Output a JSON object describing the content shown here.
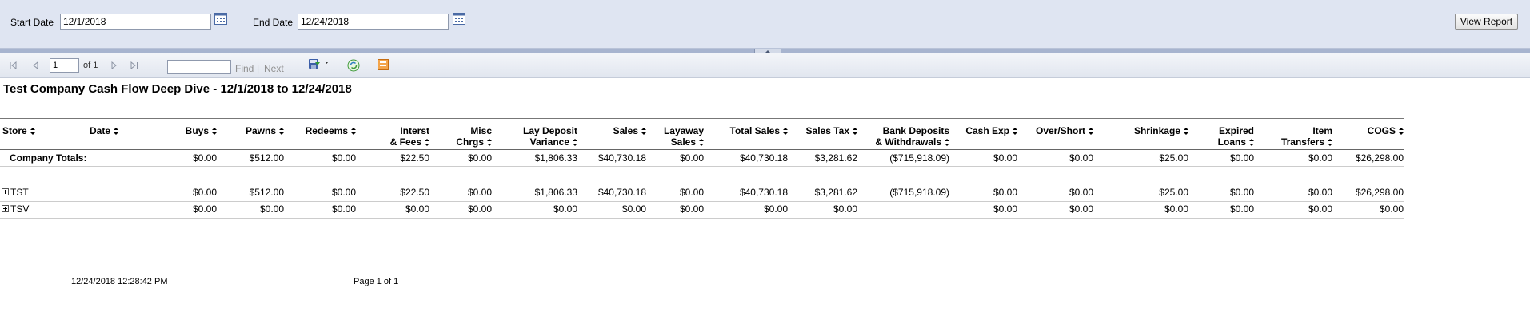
{
  "params": {
    "start_label": "Start Date",
    "start_value": "12/1/2018",
    "end_label": "End Date",
    "end_value": "12/24/2018",
    "view_button": "View Report"
  },
  "toolbar": {
    "page_value": "1",
    "of_text": "of 1",
    "find_label": "Find",
    "separator": "|",
    "next_label": "Next"
  },
  "report": {
    "title": "Test Company Cash Flow Deep Dive - 12/1/2018 to 12/24/2018",
    "columns": [
      {
        "l1": "",
        "l2": "Store"
      },
      {
        "l1": "",
        "l2": "Date"
      },
      {
        "l1": "",
        "l2": "Buys"
      },
      {
        "l1": "",
        "l2": "Pawns"
      },
      {
        "l1": "",
        "l2": "Redeems"
      },
      {
        "l1": "Interst",
        "l2": "& Fees"
      },
      {
        "l1": "Misc",
        "l2": "Chrgs"
      },
      {
        "l1": "Lay Deposit",
        "l2": "Variance"
      },
      {
        "l1": "",
        "l2": "Sales"
      },
      {
        "l1": "Layaway",
        "l2": "Sales"
      },
      {
        "l1": "",
        "l2": "Total Sales"
      },
      {
        "l1": "",
        "l2": "Sales Tax"
      },
      {
        "l1": "Bank Deposits",
        "l2": "& Withdrawals"
      },
      {
        "l1": "",
        "l2": "Cash Exp"
      },
      {
        "l1": "",
        "l2": "Over/Short"
      },
      {
        "l1": "",
        "l2": "Shrinkage"
      },
      {
        "l1": "Expired",
        "l2": "Loans"
      },
      {
        "l1": "Item",
        "l2": "Transfers"
      },
      {
        "l1": "",
        "l2": "COGS"
      }
    ],
    "totals": {
      "label": "Company Totals:",
      "values": [
        "$0.00",
        "$512.00",
        "$0.00",
        "$22.50",
        "$0.00",
        "$1,806.33",
        "$40,730.18",
        "$0.00",
        "$40,730.18",
        "$3,281.62",
        "($715,918.09)",
        "$0.00",
        "$0.00",
        "$25.00",
        "$0.00",
        "$0.00",
        "$26,298.00"
      ]
    },
    "rows": [
      {
        "store": "TST",
        "values": [
          "$0.00",
          "$512.00",
          "$0.00",
          "$22.50",
          "$0.00",
          "$1,806.33",
          "$40,730.18",
          "$0.00",
          "$40,730.18",
          "$3,281.62",
          "($715,918.09)",
          "$0.00",
          "$0.00",
          "$25.00",
          "$0.00",
          "$0.00",
          "$26,298.00"
        ]
      },
      {
        "store": "TSV",
        "values": [
          "$0.00",
          "$0.00",
          "$0.00",
          "$0.00",
          "$0.00",
          "$0.00",
          "$0.00",
          "$0.00",
          "$0.00",
          "$0.00",
          "",
          "$0.00",
          "$0.00",
          "$0.00",
          "$0.00",
          "$0.00",
          "$0.00"
        ]
      }
    ]
  },
  "footer": {
    "timestamp": "12/24/2018 12:28:42 PM",
    "page_info": "Page 1 of 1"
  }
}
